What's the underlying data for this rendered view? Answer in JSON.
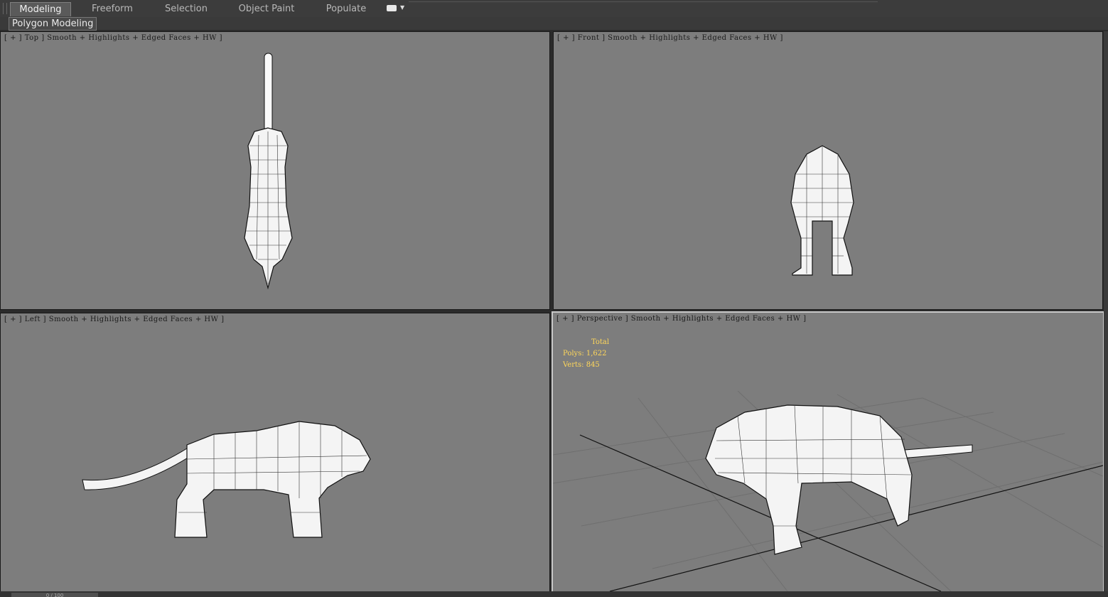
{
  "ribbon": {
    "tabs": [
      {
        "label": "Modeling",
        "active": true
      },
      {
        "label": "Freeform",
        "active": false
      },
      {
        "label": "Selection",
        "active": false
      },
      {
        "label": "Object Paint",
        "active": false
      },
      {
        "label": "Populate",
        "active": false
      }
    ],
    "panel_label": "Polygon Modeling",
    "extra_icon": "dropdown-toggle-icon"
  },
  "viewports": {
    "top": {
      "label": "[ + ] Top ] Smooth + Highlights + Edged Faces + HW ]"
    },
    "front": {
      "label": "[ + ] Front ] Smooth + Highlights + Edged Faces + HW ]"
    },
    "left": {
      "label": "[ + ] Left ] Smooth + Highlights + Edged Faces + HW ]"
    },
    "perspective": {
      "label": "[ + ] Perspective ] Smooth + Highlights + Edged Faces + HW ]",
      "stats": {
        "title": "Total",
        "polys": "Polys: 1,622",
        "verts": "Verts: 845"
      }
    }
  },
  "timeline": {
    "frame": "0 / 100"
  },
  "colors": {
    "viewport_bg": "#7d7d7d",
    "stats_text": "#ffd75a",
    "ui_dark": "#2b2b2b"
  }
}
